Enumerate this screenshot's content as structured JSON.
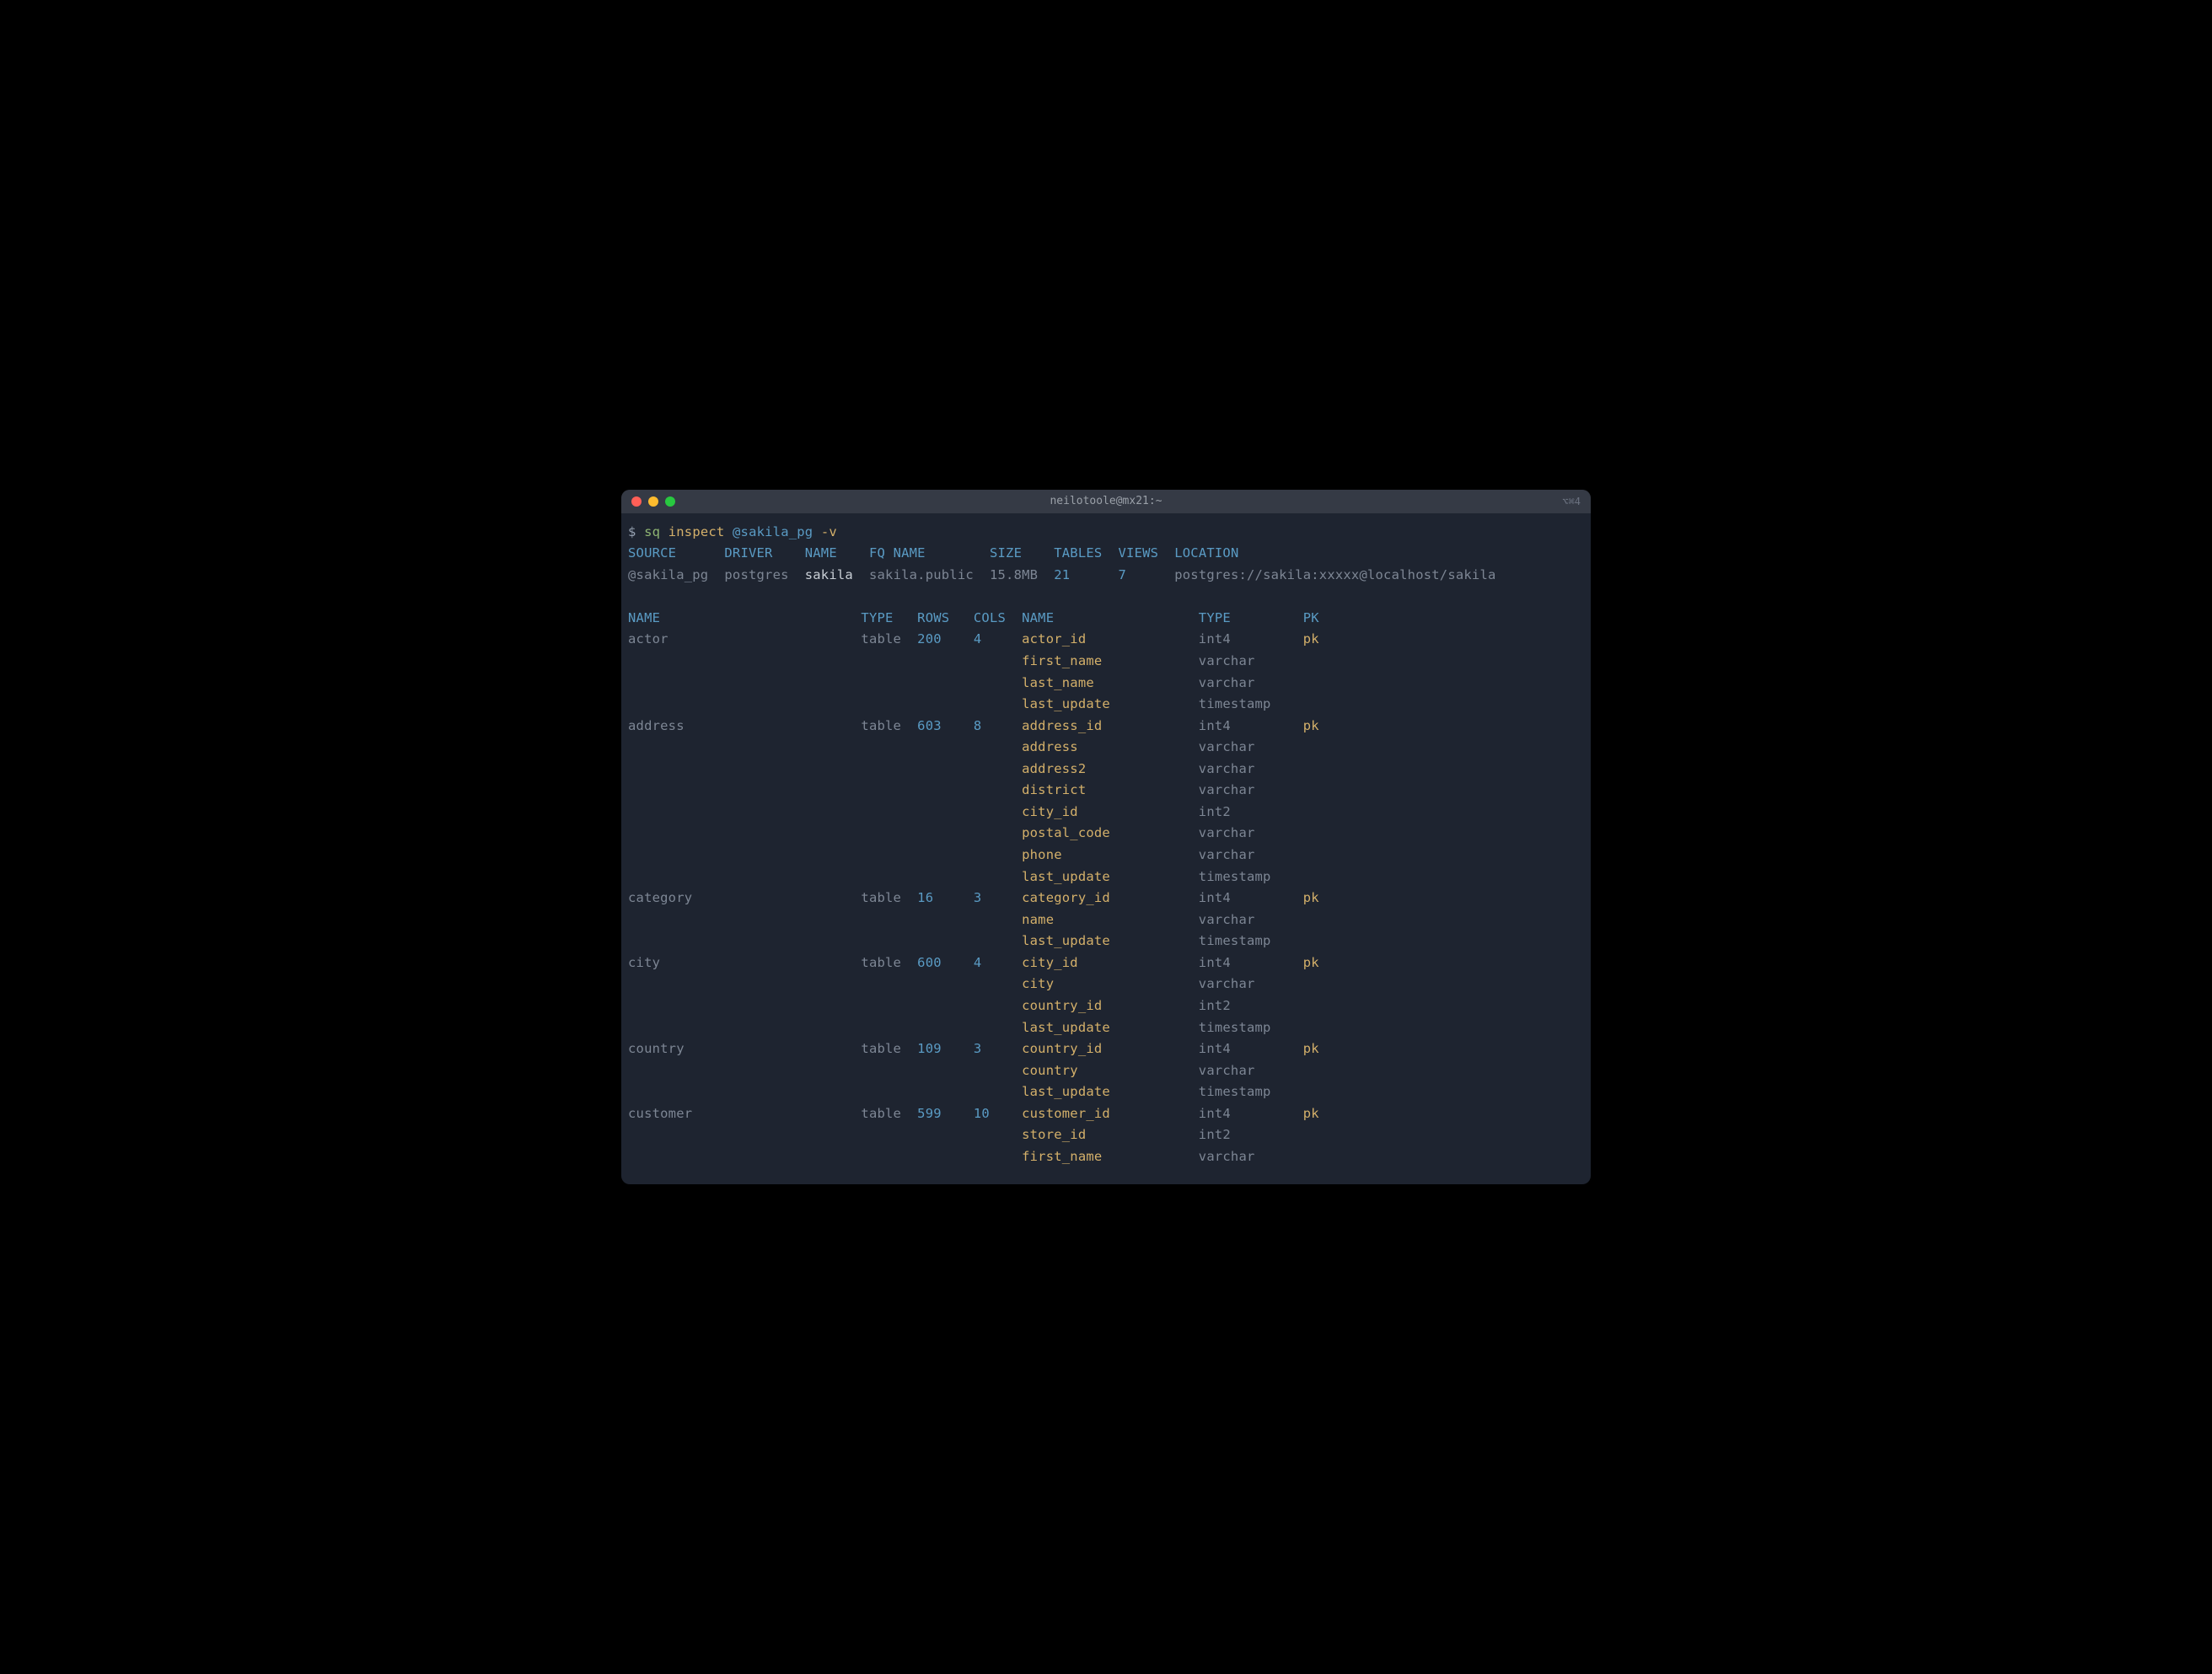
{
  "window": {
    "title": "neilotoole@mx21:~",
    "shortcut": "⌥⌘4"
  },
  "command": {
    "prompt": "$",
    "exe": "sq",
    "sub": "inspect",
    "arg": "@sakila_pg",
    "flag": "-v"
  },
  "summary_headers": {
    "source": "SOURCE",
    "driver": "DRIVER",
    "name": "NAME",
    "fqname": "FQ NAME",
    "size": "SIZE",
    "tables": "TABLES",
    "views": "VIEWS",
    "location": "LOCATION"
  },
  "summary": {
    "source": "@sakila_pg",
    "driver": "postgres",
    "name": "sakila",
    "fqname": "sakila.public",
    "size": "15.8MB",
    "tables": "21",
    "views": "7",
    "location": "postgres://sakila:xxxxx@localhost/sakila"
  },
  "detail_headers": {
    "name": "NAME",
    "type": "TYPE",
    "rows": "ROWS",
    "cols": "COLS",
    "cname": "NAME",
    "ctype": "TYPE",
    "pk": "PK"
  },
  "tables": [
    {
      "name": "actor",
      "type": "table",
      "rows": "200",
      "cols": "4",
      "columns": [
        {
          "name": "actor_id",
          "type": "int4",
          "pk": "pk"
        },
        {
          "name": "first_name",
          "type": "varchar",
          "pk": ""
        },
        {
          "name": "last_name",
          "type": "varchar",
          "pk": ""
        },
        {
          "name": "last_update",
          "type": "timestamp",
          "pk": ""
        }
      ]
    },
    {
      "name": "address",
      "type": "table",
      "rows": "603",
      "cols": "8",
      "columns": [
        {
          "name": "address_id",
          "type": "int4",
          "pk": "pk"
        },
        {
          "name": "address",
          "type": "varchar",
          "pk": ""
        },
        {
          "name": "address2",
          "type": "varchar",
          "pk": ""
        },
        {
          "name": "district",
          "type": "varchar",
          "pk": ""
        },
        {
          "name": "city_id",
          "type": "int2",
          "pk": ""
        },
        {
          "name": "postal_code",
          "type": "varchar",
          "pk": ""
        },
        {
          "name": "phone",
          "type": "varchar",
          "pk": ""
        },
        {
          "name": "last_update",
          "type": "timestamp",
          "pk": ""
        }
      ]
    },
    {
      "name": "category",
      "type": "table",
      "rows": "16",
      "cols": "3",
      "columns": [
        {
          "name": "category_id",
          "type": "int4",
          "pk": "pk"
        },
        {
          "name": "name",
          "type": "varchar",
          "pk": ""
        },
        {
          "name": "last_update",
          "type": "timestamp",
          "pk": ""
        }
      ]
    },
    {
      "name": "city",
      "type": "table",
      "rows": "600",
      "cols": "4",
      "columns": [
        {
          "name": "city_id",
          "type": "int4",
          "pk": "pk"
        },
        {
          "name": "city",
          "type": "varchar",
          "pk": ""
        },
        {
          "name": "country_id",
          "type": "int2",
          "pk": ""
        },
        {
          "name": "last_update",
          "type": "timestamp",
          "pk": ""
        }
      ]
    },
    {
      "name": "country",
      "type": "table",
      "rows": "109",
      "cols": "3",
      "columns": [
        {
          "name": "country_id",
          "type": "int4",
          "pk": "pk"
        },
        {
          "name": "country",
          "type": "varchar",
          "pk": ""
        },
        {
          "name": "last_update",
          "type": "timestamp",
          "pk": ""
        }
      ]
    },
    {
      "name": "customer",
      "type": "table",
      "rows": "599",
      "cols": "10",
      "columns": [
        {
          "name": "customer_id",
          "type": "int4",
          "pk": "pk"
        },
        {
          "name": "store_id",
          "type": "int2",
          "pk": ""
        },
        {
          "name": "first_name",
          "type": "varchar",
          "pk": ""
        }
      ]
    }
  ]
}
